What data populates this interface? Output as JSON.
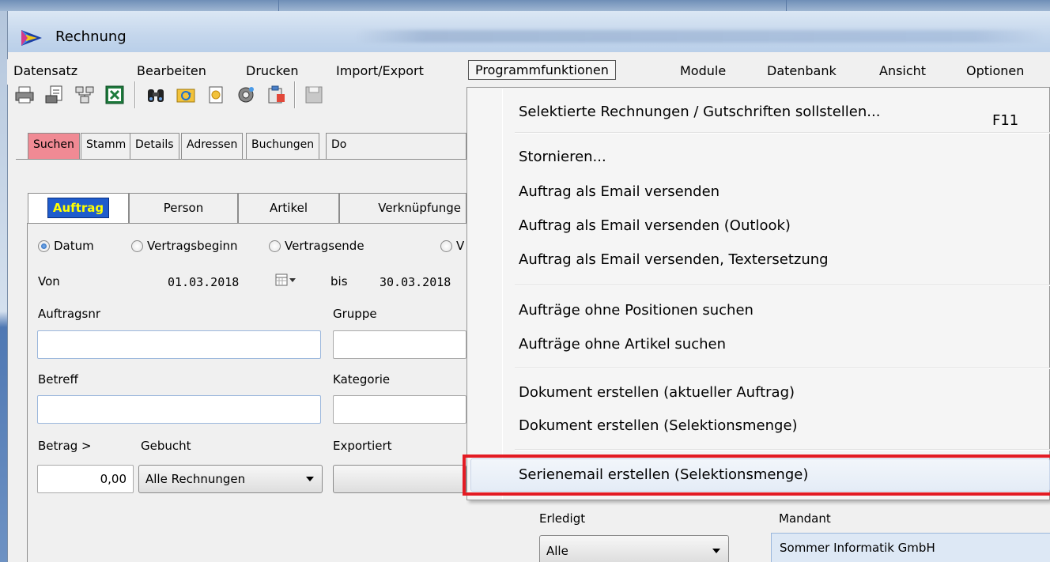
{
  "window": {
    "title": "Rechnung"
  },
  "menubar": {
    "items": [
      "Datensatz",
      "Bearbeiten",
      "Drucken",
      "Import/Export",
      "Programmfunktionen",
      "Module",
      "Datenbank",
      "Ansicht",
      "Optionen"
    ],
    "active": "Programmfunktionen"
  },
  "toolbar": {
    "icons": [
      "print-icon",
      "print-preview-icon",
      "network-icon",
      "excel-icon",
      "binoculars-icon",
      "refresh-folder-icon",
      "new-doc-icon",
      "settings-icon",
      "clipboard-icon",
      "save-icon"
    ]
  },
  "tabs_top": [
    "Suchen",
    "Stamm",
    "Details",
    "Adressen",
    "Buchungen",
    "Do"
  ],
  "tabs_search": [
    "Auftrag",
    "Person",
    "Artikel",
    "Verknüpfunge"
  ],
  "search": {
    "radios": [
      "Datum",
      "Vertragsbeginn",
      "Vertragsende",
      "V"
    ],
    "von_label": "Von",
    "von_value": "01.03.2018",
    "bis_label": "bis",
    "bis_value": "30.03.2018",
    "auftragsnr_label": "Auftragsnr",
    "gruppe_label": "Gruppe",
    "betreff_label": "Betreff",
    "kategorie_label": "Kategorie",
    "betrag_label": "Betrag >",
    "betrag_value": "0,00",
    "gebucht_label": "Gebucht",
    "gebucht_value": "Alle Rechnungen",
    "exportiert_label": "Exportiert",
    "erledigt_label": "Erledigt",
    "erledigt_value": "Alle",
    "mandant_label": "Mandant",
    "mandant_value": "Sommer Informatik GmbH"
  },
  "dropdown": {
    "items": [
      {
        "label": "Selektierte Rechnungen / Gutschriften sollstellen...",
        "shortcut": "F11"
      },
      {
        "label": "Stornieren..."
      },
      {
        "label": "Auftrag als Email versenden"
      },
      {
        "label": "Auftrag als Email versenden (Outlook)"
      },
      {
        "label": "Auftrag als Email versenden, Textersetzung"
      },
      {
        "label": "Aufträge ohne Positionen suchen"
      },
      {
        "label": "Aufträge ohne Artikel suchen"
      },
      {
        "label": "Dokument erstellen (aktueller Auftrag)"
      },
      {
        "label": "Dokument erstellen (Selektionsmenge)"
      },
      {
        "label": "Serienemail erstellen (Selektionsmenge)"
      }
    ],
    "highlighted": "Serienemail erstellen (Selektionsmenge)",
    "highlight_color": "#e31b23"
  },
  "colors": {
    "active_tab": "#f08a94",
    "auftrag_tab_bg": "#1f5ccc",
    "auftrag_tab_text": "#ffff00"
  }
}
